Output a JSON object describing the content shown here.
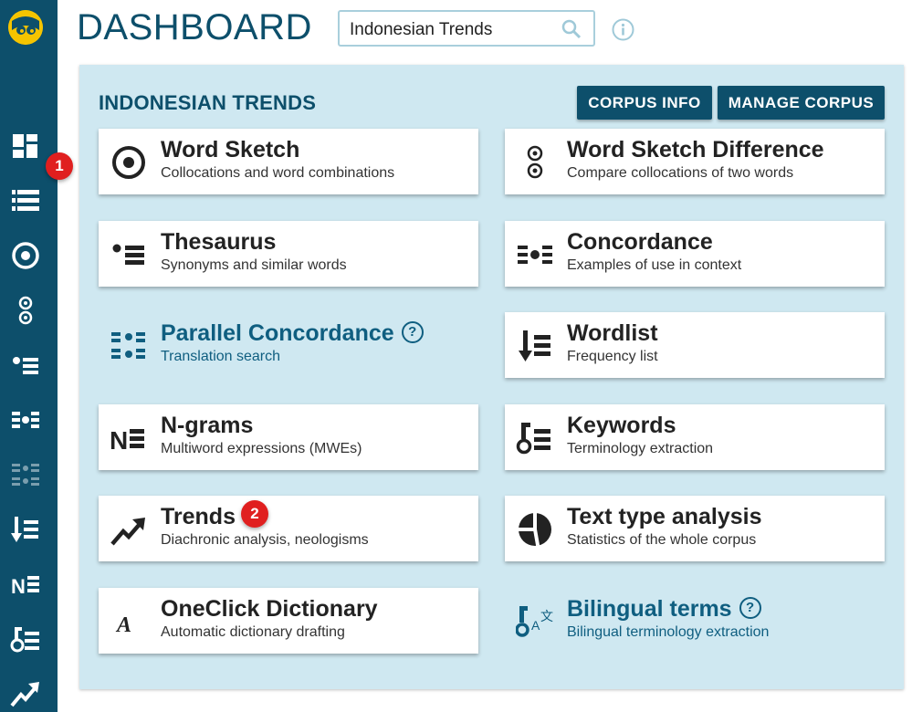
{
  "header": {
    "title": "DASHBOARD",
    "search_value": "Indonesian Trends",
    "icons": {
      "search": "search-icon",
      "info": "info-icon"
    }
  },
  "sidebar": {
    "logo": "sketch-engine-logo",
    "items": [
      "dashboard-icon",
      "corpus-list-icon",
      "word-sketch-icon",
      "word-sketch-difference-icon",
      "thesaurus-icon",
      "concordance-icon",
      "parallel-concordance-icon",
      "wordlist-icon",
      "ngrams-icon",
      "keywords-icon",
      "trends-icon"
    ]
  },
  "badges": {
    "one": "1",
    "two": "2"
  },
  "panel": {
    "corpus_name": "INDONESIAN TRENDS",
    "corpus_info_label": "CORPUS INFO",
    "manage_corpus_label": "MANAGE CORPUS"
  },
  "cards": [
    {
      "title": "Word Sketch",
      "subtitle": "Collocations and word combinations",
      "icon": "word-sketch-icon"
    },
    {
      "title": "Word Sketch Difference",
      "subtitle": "Compare collocations of two words",
      "icon": "word-sketch-difference-icon"
    },
    {
      "title": "Thesaurus",
      "subtitle": "Synonyms and similar words",
      "icon": "thesaurus-icon"
    },
    {
      "title": "Concordance",
      "subtitle": "Examples of use in context",
      "icon": "concordance-icon"
    },
    {
      "title": "Parallel Concordance",
      "subtitle": "Translation search",
      "icon": "parallel-concordance-icon",
      "help": "?"
    },
    {
      "title": "Wordlist",
      "subtitle": "Frequency list",
      "icon": "wordlist-icon"
    },
    {
      "title": "N-grams",
      "subtitle": "Multiword expressions (MWEs)",
      "icon": "ngrams-icon"
    },
    {
      "title": "Keywords",
      "subtitle": "Terminology extraction",
      "icon": "keywords-icon"
    },
    {
      "title": "Trends",
      "subtitle": "Diachronic analysis, neologisms",
      "icon": "trends-icon"
    },
    {
      "title": "Text type analysis",
      "subtitle": "Statistics of the whole corpus",
      "icon": "text-type-analysis-icon"
    },
    {
      "title": "OneClick Dictionary",
      "subtitle": "Automatic dictionary drafting",
      "icon": "oneclick-dictionary-icon"
    },
    {
      "title": "Bilingual terms",
      "subtitle": "Bilingual terminology extraction",
      "icon": "bilingual-terms-icon",
      "help": "?"
    }
  ],
  "colors": {
    "brand_dark": "#0d4f6b",
    "panel_bg": "#cfe8f1",
    "link_blue": "#0f5e80",
    "badge_red": "#e01f1f",
    "logo_yellow": "#f5c400"
  }
}
